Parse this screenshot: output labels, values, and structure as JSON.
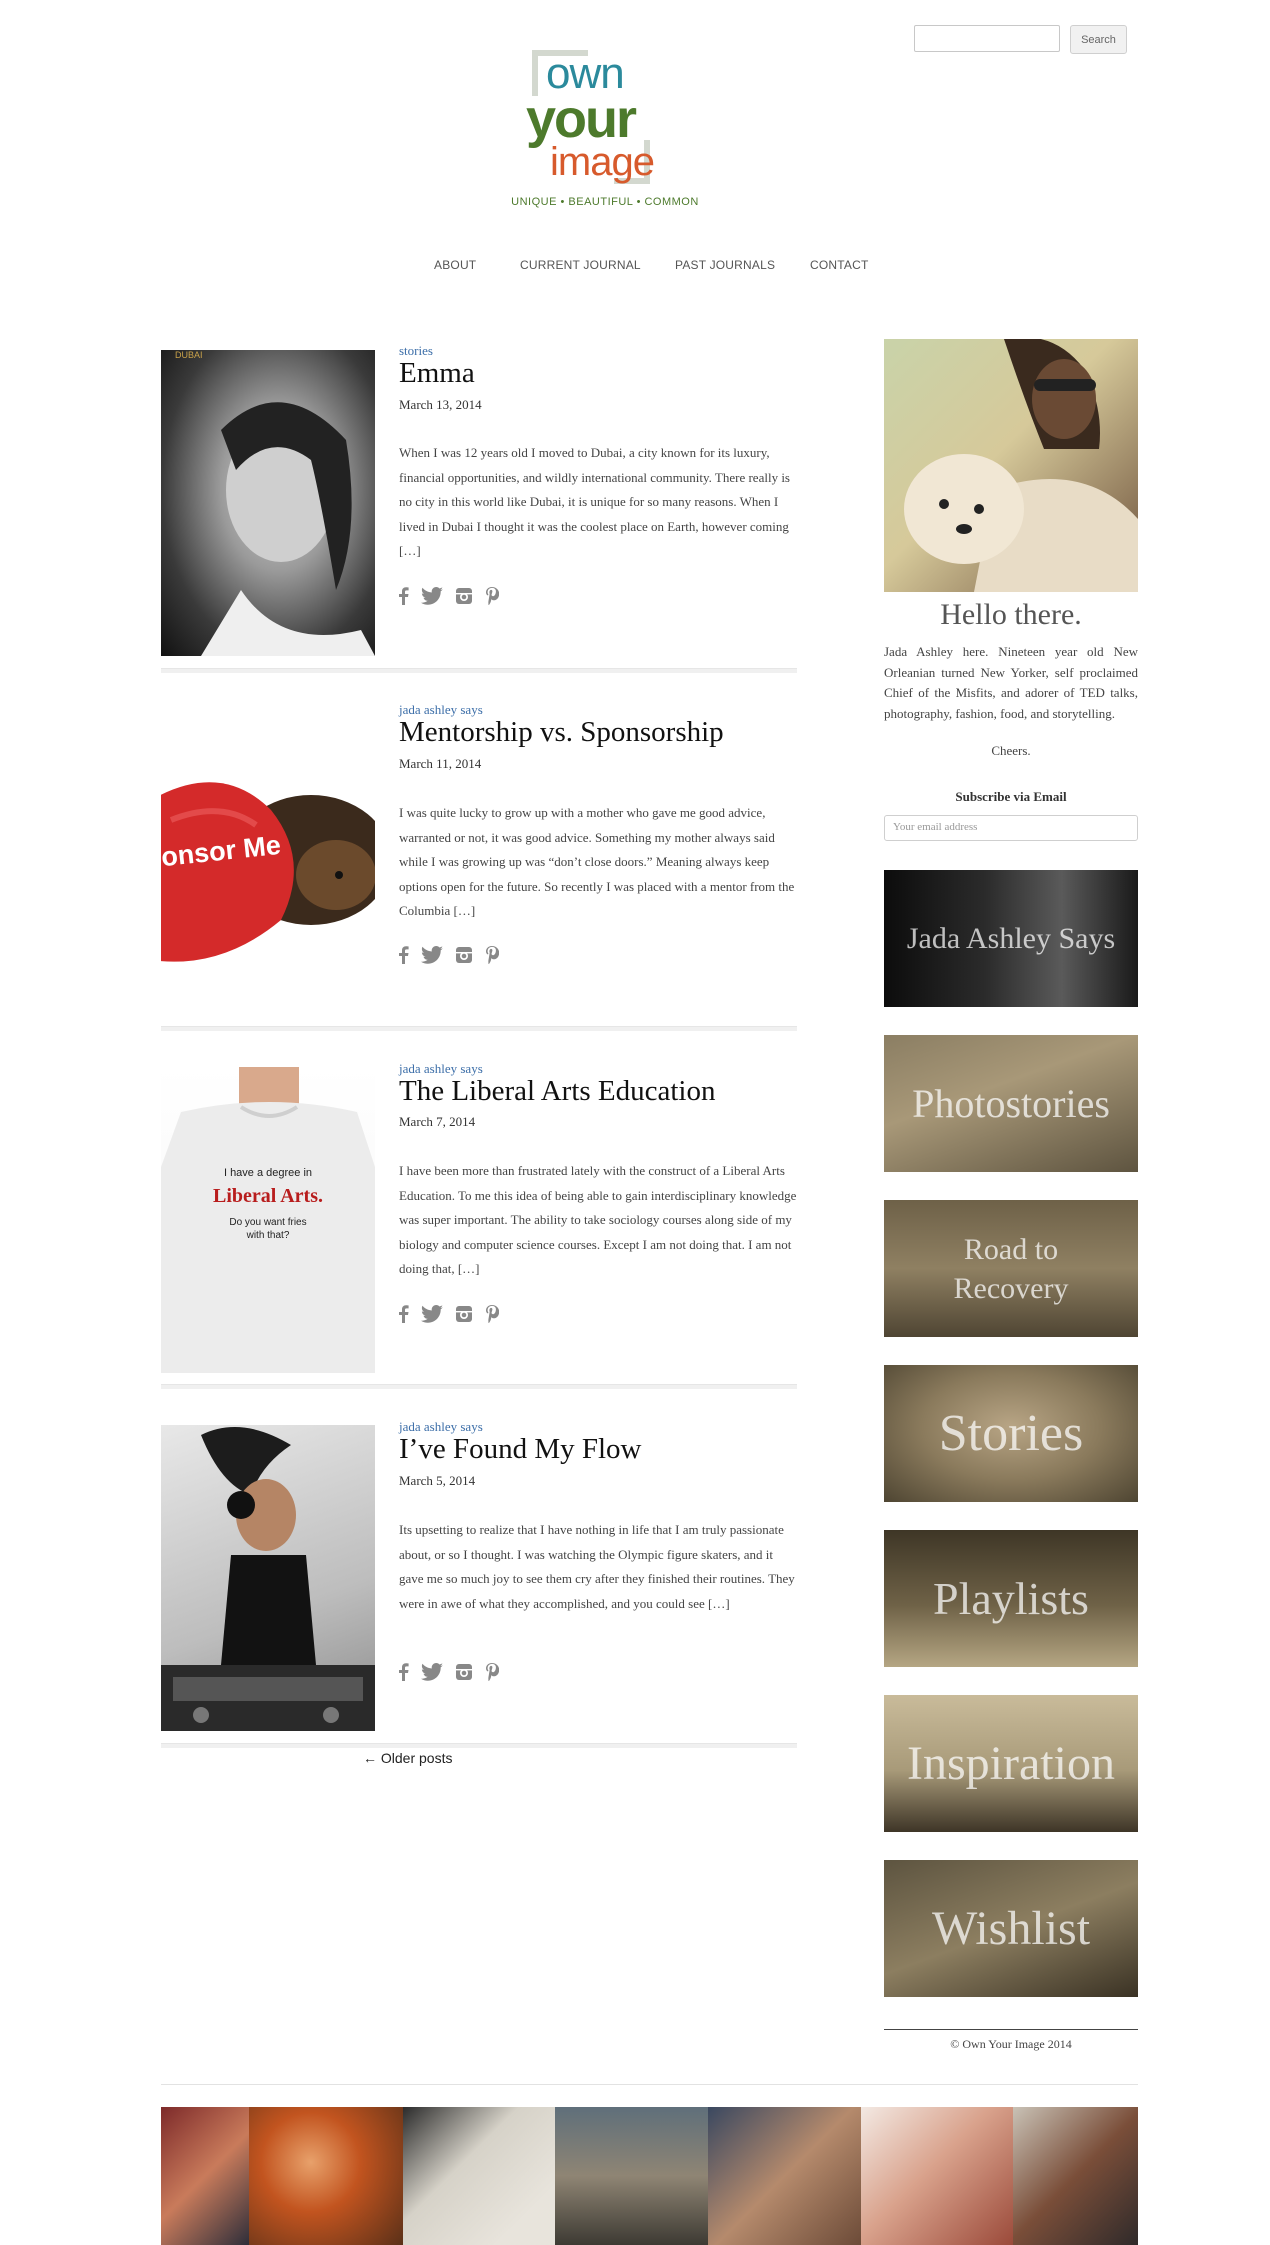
{
  "search": {
    "placeholder": "",
    "button_label": "Search"
  },
  "logo": {
    "line1": "own",
    "line2": "your",
    "line3": "image",
    "tagline": "UNIQUE • BEAUTIFUL • COMMON"
  },
  "nav": [
    "ABOUT",
    "CURRENT JOURNAL",
    "PAST JOURNALS",
    "CONTACT"
  ],
  "posts": [
    {
      "category": "stories",
      "title": "Emma",
      "date": "March 13, 2014",
      "excerpt": "When I was 12 years old I moved to Dubai, a city known for its luxury, financial opportunities, and wildly international community. There really is no city in this world like Dubai, it is unique for so many reasons. When I lived in Dubai I thought it was the coolest place on Earth, however coming […]",
      "image_caption": "DUBAI"
    },
    {
      "category": "jada ashley says",
      "title": "Mentorship vs. Sponsorship",
      "date": "March 11, 2014",
      "excerpt": "I was quite lucky to grow up with a mother who gave me good advice, warranted or not, it was good advice. Something my mother always said while I was growing up was “don’t close doors.” Meaning always keep options open for the future. So recently I was placed with a mentor from the Columbia […]",
      "image_caption": "onsor Me"
    },
    {
      "category": "jada ashley says",
      "title": "The Liberal Arts Education",
      "date": "March 7, 2014",
      "excerpt": "I have been more than frustrated lately with the construct of a Liberal Arts Education. To me this idea of being able to gain interdisciplinary knowledge was super important. The ability to take sociology courses along side of my biology and computer science courses. Except I am not doing that. I am not doing that, […]",
      "image_caption": [
        "I have a degree in",
        "Liberal Arts.",
        "Do you want fries",
        "with that?"
      ]
    },
    {
      "category": "jada ashley says",
      "title": "I’ve Found My Flow",
      "date": "March 5, 2014",
      "excerpt": "Its upsetting to realize that I have nothing in life that I am truly passionate about, or so I thought. I was watching the Olympic figure skaters, and it gave me so much joy to see them cry after they finished their routines. They were in awe of what they accomplished, and you could see […]",
      "image_caption": ""
    }
  ],
  "social_icons": [
    "facebook-icon",
    "twitter-icon",
    "instagram-icon",
    "pinterest-icon"
  ],
  "older_posts": "← Older posts",
  "sidebar": {
    "hello": "Hello there.",
    "bio": "Jada Ashley here. Nineteen year old New Orleanian turned New Yorker, self proclaimed Chief of the Misfits, and adorer of TED talks, photography, fashion, food, and storytelling.",
    "cheers": "Cheers.",
    "subscribe_title": "Subscribe via Email",
    "subscribe_placeholder": "Your email address",
    "tiles": [
      {
        "label": "Jada Ashley Says"
      },
      {
        "label": "Photostories"
      },
      {
        "label": "Road to Recovery"
      },
      {
        "label": "Stories"
      },
      {
        "label": "Playlists"
      },
      {
        "label": "Inspiration"
      },
      {
        "label": "Wishlist"
      }
    ],
    "copyright": "© Own Your Image 2014"
  },
  "instagram_strip_note": "",
  "colors": {
    "link_blue": "#3c6ea8",
    "logo_teal": "#2b8a9c",
    "logo_green": "#4d7a2c",
    "logo_orange": "#d75a2c"
  }
}
